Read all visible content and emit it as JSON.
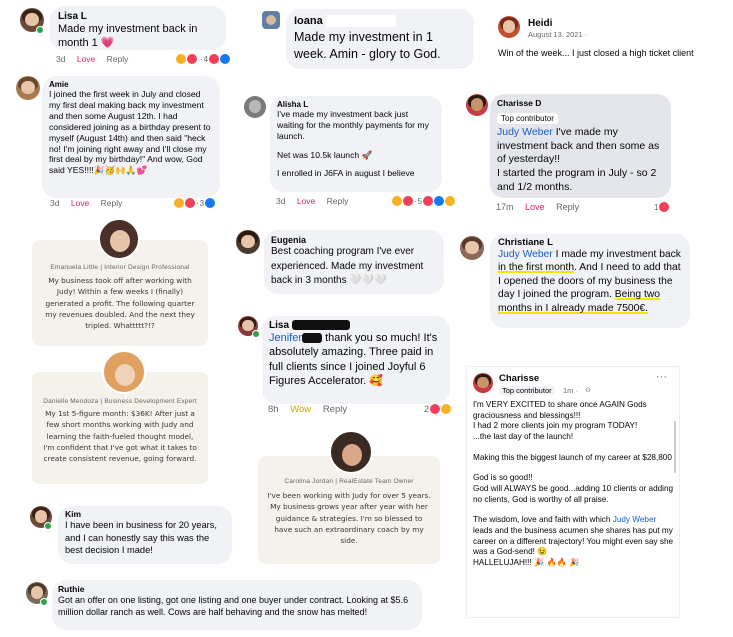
{
  "lisa1": {
    "name": "Lisa L",
    "text": "Made my investment back in month 1",
    "emoji": "💗",
    "time": "3d",
    "love": "Love",
    "reply": "Reply",
    "count": "4"
  },
  "ioana": {
    "name": "Ioana",
    "text": "Made my investment in 1 week. Amin - glory to God."
  },
  "heidi": {
    "name": "Heidi",
    "date": "August 13, 2021 ·",
    "text": "Win of the week... I just closed a high ticket client"
  },
  "amie": {
    "name": "Amie",
    "text": "I joined the first week in July and closed my first deal making back my investment and then some August 12th. I had considered joining as a birthday present to myself (August 14th) and then said \"heck no! I'm joining right away and I'll close my first deal by my birthday!\" And wow, God said YES!!!!🎉🥳🙌🙏💕",
    "time": "3d",
    "love": "Love",
    "reply": "Reply",
    "count": "3"
  },
  "alisha": {
    "name": "Alisha L",
    "text1": "I've made my investment back just waiting for the monthly payments for my launch.",
    "text2": "Net was 10.5k launch 🚀",
    "text3": "I enrolled in J6FA in august I believe",
    "time": "3d",
    "love": "Love",
    "reply": "Reply",
    "count": "5"
  },
  "charisse1": {
    "name": "Charisse D",
    "badge": "Top contributor",
    "mention": "Judy Weber",
    "text1": " I've made my investment back and then some as of yesterday!!",
    "text2": "I started the program in July - so 2 and 1/2 months.",
    "time": "17m",
    "love": "Love",
    "reply": "Reply",
    "count": "1"
  },
  "emanuela": {
    "caption": "Emanuela Little | Interior Design Professional",
    "text": "My business took off after working with Judy! Within a few weeks I (finally) generated a profit. The following quarter my revenues doubled. And the next they tripled. Whattttt?!?"
  },
  "eugenia": {
    "name": "Eugenia",
    "text": "Best coaching program I've ever experienced. Made my investment back in 3 months 🤍🤍🤍"
  },
  "christiane": {
    "name": "Christiane L",
    "mention": "Judy Weber",
    "text_a": " I made my investment back ",
    "hl1": "in the first month",
    "text_b": ". And I need to add that I opened the doors of my business the day I joined the program. ",
    "hl2": "Being two months in I already made 7500€."
  },
  "danielle": {
    "caption": "Danielle Mendoza | Business Development Expert",
    "text": "My 1st 5-figure month: $36K! After just a few short months working with Judy and learning the faith-fueled thought model, I'm confident that I've got what it takes to create consistent revenue, going forward."
  },
  "lisa2": {
    "name": "Lisa",
    "mention": "Jenifer",
    "text": " thank you so much! It's absolutely amazing. Three paid in full clients since I joined Joyful 6 Figures Accelerator. 🥰",
    "time": "8h",
    "wow": "Wow",
    "reply": "Reply",
    "count": "2"
  },
  "charisse2": {
    "name": "Charisse",
    "badge": "Top contributor",
    "badge_time": "1m ·",
    "more": "···",
    "p1": "I'm VERY EXCITED to share once AGAIN Gods graciousness and blessings!!!",
    "p2": "I had 2 more clients join my program TODAY!",
    "p3": "...the last day of the launch!",
    "p4": "Making this the biggest launch of my career at $28,800",
    "p5": "God is so good!!",
    "p6": "God will ALWAYS be good...adding 10 clients or adding no clients, God is worthy of all praise.",
    "p7a": "The wisdom, love and faith with which ",
    "p7m": "Judy Weber",
    "p7b": " leads and the business acumen she shares has put my career on a different trajectory! You might even say she was a God-send! 😉",
    "p8": "HALLELUJAH!!! 🎉 🔥🔥 🎉"
  },
  "carolina": {
    "caption": "Carolina Jordan | RealEstate Team Owner",
    "text": "I've been working with Judy for over 5 years. My business grows year after year with her guidance & strategies. I'm so blessed to have such an extraordinary coach by my side."
  },
  "kim": {
    "name": "Kim",
    "text": "I have been in business for 20 years, and I can honestly say this was the best decision I made!"
  },
  "ruthie": {
    "name": "Ruthie",
    "text": "Got an offer on one listing, got one listing and one buyer under contract. Looking at $5.6 million dollar ranch as well. Cows are half behaving and the snow has melted!"
  }
}
